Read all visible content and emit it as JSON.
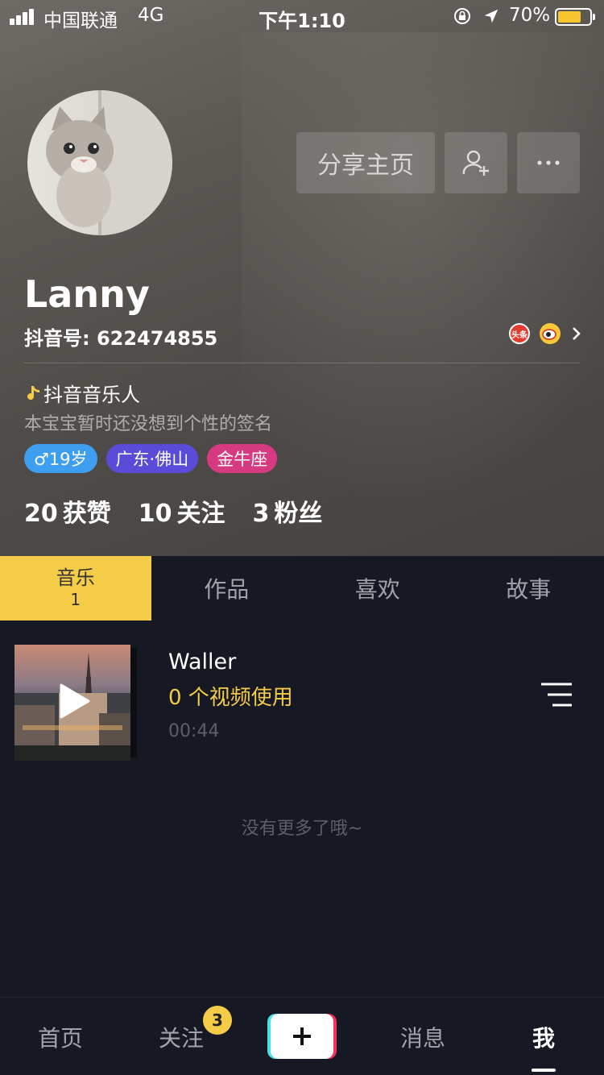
{
  "status_bar": {
    "carrier": "中国联通",
    "network": "4G",
    "time": "下午1:10",
    "battery_percent": "70%",
    "battery_level": 0.7,
    "icons": [
      "signal-icon",
      "rotation-lock-icon",
      "location-arrow-icon",
      "battery-icon"
    ]
  },
  "profile": {
    "share_label": "分享主页",
    "name": "Lanny",
    "douyin_id": "抖音号: 622474855",
    "toutiao_badge": "头条",
    "music_title": "抖音音乐人",
    "signature": "本宝宝暂时还没想到个性的签名",
    "tags": {
      "age": "♂19岁",
      "location": "广东·佛山",
      "zodiac": "金牛座"
    },
    "stats": {
      "likes_count": "20",
      "likes_label": "获赞",
      "following_count": "10",
      "following_label": "关注",
      "fans_count": "3",
      "fans_label": "粉丝"
    }
  },
  "tabs": {
    "music": {
      "label": "音乐",
      "count": "1"
    },
    "works": "作品",
    "likes": "喜欢",
    "stories": "故事"
  },
  "music_list": [
    {
      "name": "Waller",
      "usage": "0 个视频使用",
      "duration": "00:44"
    }
  ],
  "no_more": "没有更多了哦~",
  "bottom_nav": {
    "home": "首页",
    "follow": "关注",
    "follow_badge": "3",
    "messages": "消息",
    "me": "我"
  },
  "colors": {
    "accent_yellow": "#f5cc47",
    "background": "#161823",
    "age_tag": "#3e9ff0",
    "location_tag": "#5a4cd8",
    "zodiac_tag": "#d63b82"
  }
}
